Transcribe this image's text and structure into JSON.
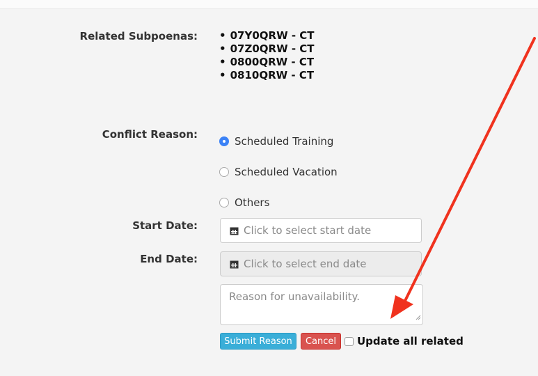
{
  "related_subpoenas": {
    "label": "Related Subpoenas:",
    "items": [
      "07Y0QRW - CT",
      "07Z0QRW - CT",
      "0800QRW - CT",
      "0810QRW - CT"
    ]
  },
  "conflict_reason": {
    "label": "Conflict Reason:",
    "options": [
      "Scheduled Training",
      "Scheduled Vacation",
      "Others"
    ],
    "selected": "Scheduled Training"
  },
  "start_date": {
    "label": "Start Date:",
    "placeholder": "Click to select start date"
  },
  "end_date": {
    "label": "End Date:",
    "placeholder": "Click to select end date"
  },
  "reason": {
    "placeholder": "Reason for unavailability."
  },
  "buttons": {
    "submit": "Submit Reason",
    "cancel": "Cancel"
  },
  "update_all_related": {
    "label": "Update all related",
    "checked": false
  },
  "colors": {
    "submit": "#3aaed8",
    "cancel": "#d9534f",
    "radio_selected": "#3b82f6",
    "annotation_arrow": "#f0321e"
  }
}
